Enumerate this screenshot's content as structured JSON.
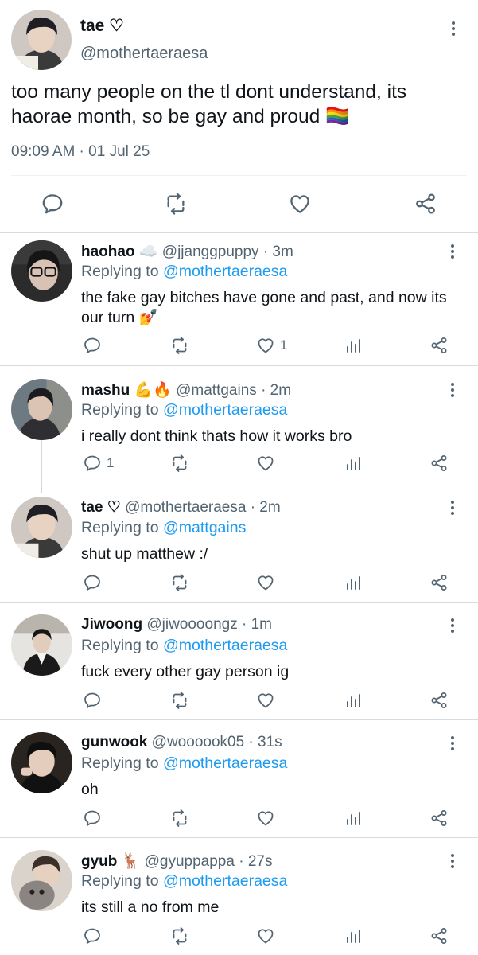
{
  "main": {
    "name": "tae ♡",
    "handle": "@mothertaeraesa",
    "text": "too many people on the tl dont understand, its haorae month, so be gay and proud 🏳️‍🌈",
    "time": "09:09 AM · 01 Jul 25",
    "icons": [
      "reply-icon",
      "retweet-icon",
      "like-icon",
      "share-icon"
    ]
  },
  "replies": [
    {
      "name": "haohao ☁️",
      "meta": "@jjanggpuppy · 3m",
      "replying_label": "Replying to",
      "replying_to": "@mothertaeraesa",
      "text": "the fake gay bitches have gone and past, and now its our turn 💅",
      "reply_count": "",
      "like_count": "1"
    },
    {
      "name": "mashu 💪🔥",
      "meta": "@mattgains · 2m",
      "replying_label": "Replying to",
      "replying_to": "@mothertaeraesa",
      "text": "i really dont think thats how it works bro",
      "reply_count": "1",
      "like_count": ""
    },
    {
      "name": "tae ♡",
      "meta": "@mothertaeraesa · 2m",
      "replying_label": "Replying to",
      "replying_to": "@mattgains",
      "text": "shut up matthew :/",
      "reply_count": "",
      "like_count": ""
    },
    {
      "name": "Jiwoong",
      "meta": "@jiwoooongz · 1m",
      "replying_label": "Replying to",
      "replying_to": "@mothertaeraesa",
      "text": "fuck every other gay person ig",
      "reply_count": "",
      "like_count": ""
    },
    {
      "name": "gunwook",
      "meta": "@woooook05 · 31s",
      "replying_label": "Replying to",
      "replying_to": "@mothertaeraesa",
      "text": "oh",
      "reply_count": "",
      "like_count": ""
    },
    {
      "name": "gyub 🦌",
      "meta": "@gyuppappa · 27s",
      "replying_label": "Replying to",
      "replying_to": "@mothertaeraesa",
      "text": "its still a no from me",
      "reply_count": "",
      "like_count": ""
    }
  ],
  "colors": {
    "accent": "#1d9bf0",
    "muted": "#536471",
    "text": "#0f1419"
  }
}
